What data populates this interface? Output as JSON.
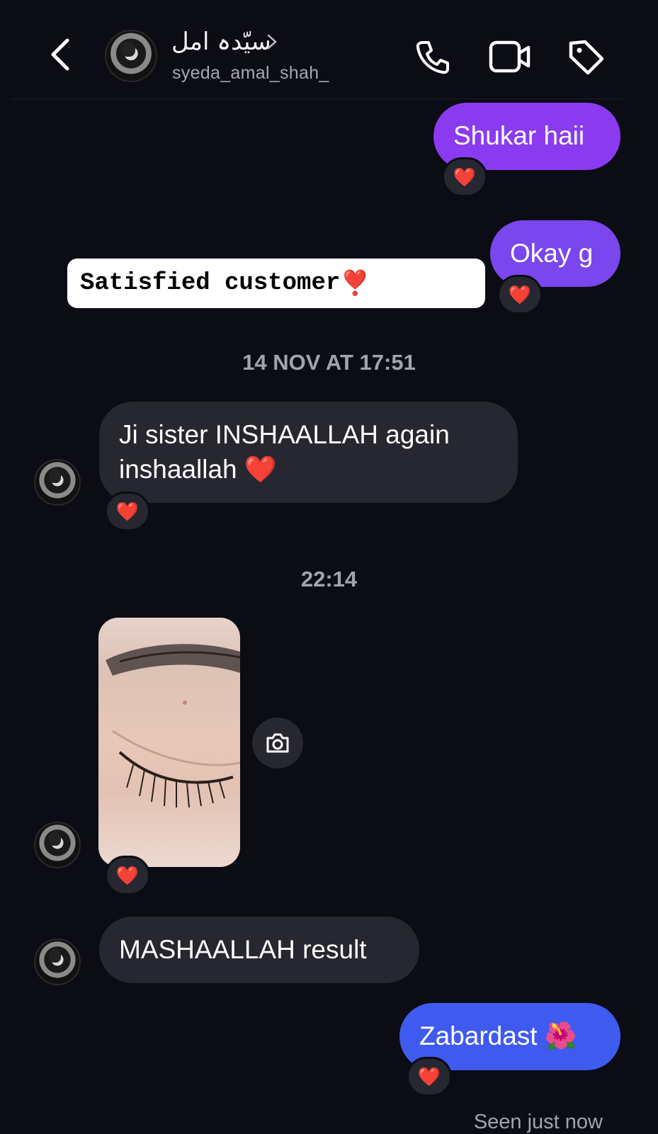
{
  "header": {
    "contact_name": "سیّدہ امل",
    "username": "syeda_amal_shah_",
    "icons": [
      "back-icon",
      "phone-icon",
      "video-camera-icon",
      "tag-icon"
    ]
  },
  "sticker": {
    "text": "Satisfied customer",
    "emoji": "❣️"
  },
  "messages": [
    {
      "text": "Shukar haii",
      "direction": "outgoing",
      "reaction": "❤️"
    },
    {
      "text": "Okay g",
      "direction": "outgoing",
      "reaction": "❤️"
    },
    {
      "text": "Ji sister INSHAALLAH again inshaallah ❤️",
      "direction": "incoming",
      "reaction": "❤️"
    },
    {
      "text": "[photo]",
      "direction": "incoming",
      "reaction": "❤️"
    },
    {
      "text": "MASHAALLAH result",
      "direction": "incoming"
    },
    {
      "text": "Zabardast 🌺",
      "direction": "outgoing",
      "reaction": "❤️"
    }
  ],
  "timestamps": [
    "14 NOV AT 17:51",
    "22:14"
  ],
  "messages_line2": "inshaallah ❤️",
  "messages_line1": "Ji sister INSHAALLAH again",
  "seen_status": "Seen just now",
  "colors": {
    "background": "#0b0c14",
    "outgoing_purple": "#8a3bf0",
    "outgoing_blue": "#3f5bef",
    "incoming": "#262730"
  }
}
